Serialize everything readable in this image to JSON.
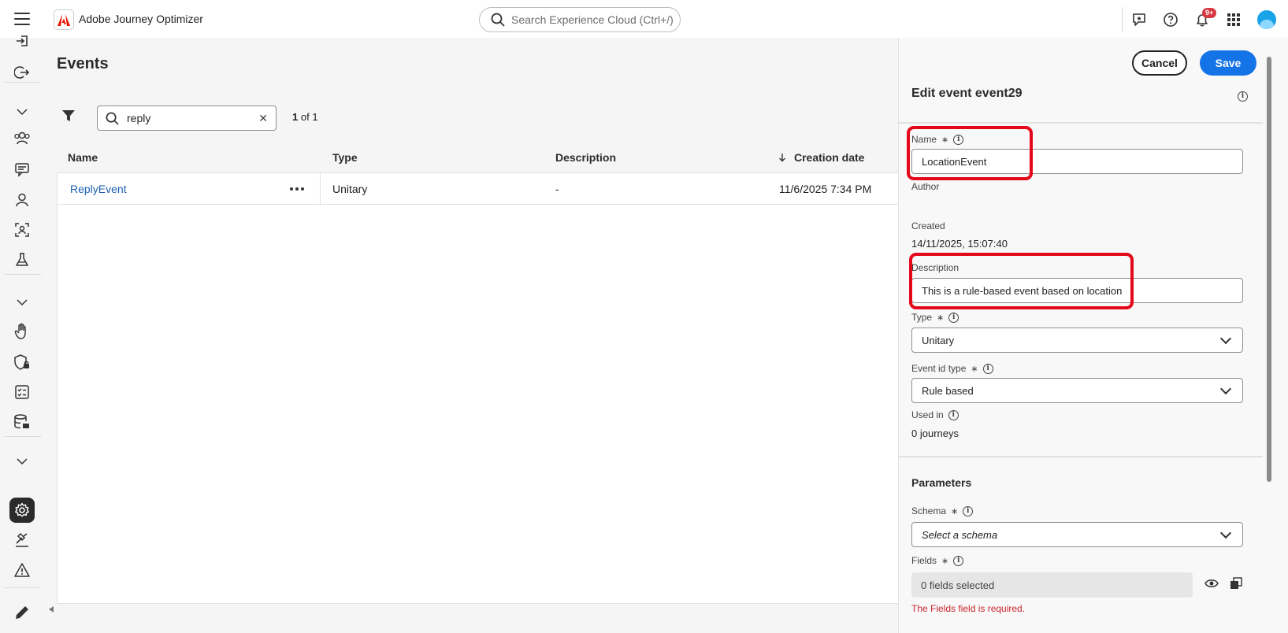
{
  "app": {
    "name": "Adobe Journey Optimizer",
    "search_placeholder": "Search Experience Cloud (Ctrl+/)",
    "notification_badge": "9+"
  },
  "rail": {
    "icons": [
      "sign-in-icon",
      "sign-out-icon",
      "chevron-down-icon",
      "people-icon",
      "message-board-icon",
      "user-icon",
      "target-user-icon",
      "beaker-icon",
      "chevron-down-icon",
      "hand-icon",
      "shield-lock-icon",
      "checklist-icon",
      "database-icon",
      "chevron-down-icon",
      "gear-icon",
      "hammer-icon",
      "alert-icon",
      "pencil-icon"
    ],
    "active": "gear-icon"
  },
  "page": {
    "title": "Events",
    "search_value": "reply",
    "result_count_current": "1",
    "result_count_total": "of 1"
  },
  "table": {
    "columns": [
      "Name",
      "Type",
      "Description",
      "Creation date"
    ],
    "sort_column": "Creation date",
    "rows": [
      {
        "name": "ReplyEvent",
        "type": "Unitary",
        "description": "-",
        "creation_date": "11/6/2025 7:34 PM"
      }
    ]
  },
  "panel": {
    "cancel_label": "Cancel",
    "save_label": "Save",
    "title": "Edit event event29",
    "name_label": "Name",
    "name_value": "LocationEvent",
    "author_label": "Author",
    "created_label": "Created",
    "created_value": "14/11/2025, 15:07:40",
    "description_label": "Description",
    "description_value": "This is a rule-based event based on location",
    "type_label": "Type",
    "type_value": "Unitary",
    "event_id_type_label": "Event id type",
    "event_id_type_value": "Rule based",
    "used_in_label": "Used in",
    "used_in_value": "0 journeys",
    "parameters_title": "Parameters",
    "schema_label": "Schema",
    "schema_placeholder": "Select a schema",
    "fields_label": "Fields",
    "fields_value": "0 fields selected",
    "fields_error": "The Fields field is required.",
    "required_mark": "∗"
  },
  "colors": {
    "accent": "#1473e6",
    "highlight": "#e3091b",
    "error": "#c9252d",
    "link": "#1d5fb3"
  }
}
